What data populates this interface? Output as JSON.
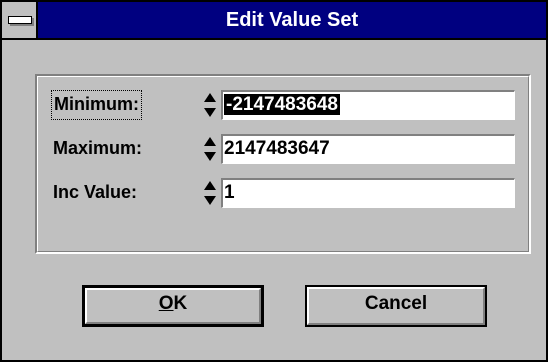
{
  "window": {
    "title": "Edit Value Set"
  },
  "fields": [
    {
      "label": "Minimum:",
      "value": "-2147483648",
      "focused": true
    },
    {
      "label": "Maximum:",
      "value": "2147483647",
      "focused": false
    },
    {
      "label": "Inc Value:",
      "value": "1",
      "focused": false
    }
  ],
  "buttons": {
    "ok": {
      "mnemonic": "O",
      "rest": "K"
    },
    "cancel": {
      "label": "Cancel"
    }
  }
}
